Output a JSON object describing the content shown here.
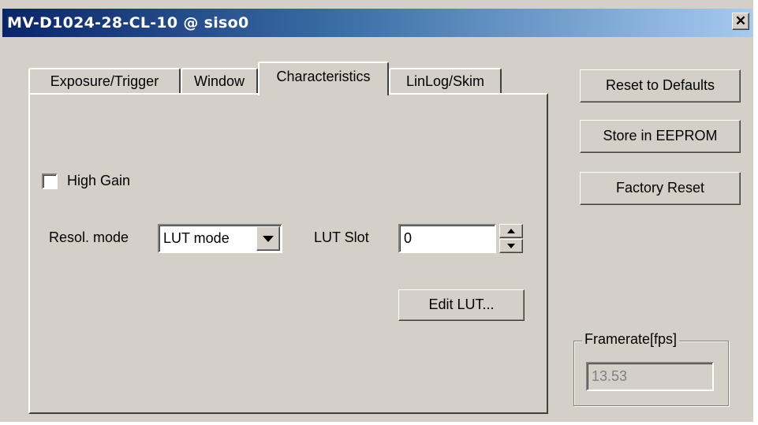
{
  "window": {
    "title": "MV-D1024-28-CL-10 @ siso0",
    "close_glyph": "✕"
  },
  "tabs": [
    {
      "label": "Exposure/Trigger",
      "active": false
    },
    {
      "label": "Window",
      "active": false
    },
    {
      "label": "Characteristics",
      "active": true
    },
    {
      "label": "LinLog/Skim",
      "active": false
    }
  ],
  "characteristics": {
    "high_gain": {
      "label": "High Gain",
      "checked": false
    },
    "resol_mode": {
      "label": "Resol. mode",
      "value": "LUT mode"
    },
    "lut_slot": {
      "label": "LUT Slot",
      "value": "0"
    },
    "edit_lut_label": "Edit LUT..."
  },
  "side_buttons": {
    "reset_defaults": "Reset to Defaults",
    "store_eeprom": "Store in EEPROM",
    "factory_reset": "Factory Reset"
  },
  "framerate": {
    "label": "Framerate[fps]",
    "value": "13.53"
  }
}
